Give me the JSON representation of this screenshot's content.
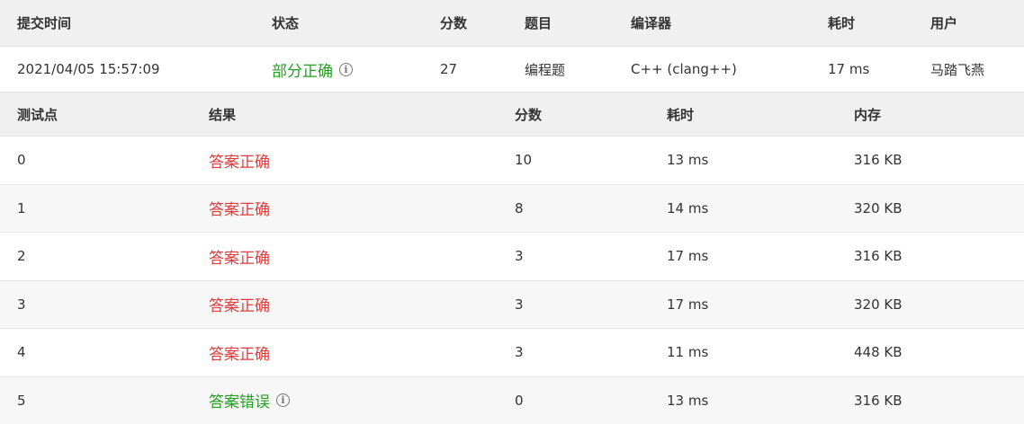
{
  "colors": {
    "accepted": "#e03c3c",
    "partial": "#22a022",
    "wrong": "#22a022",
    "header_bg": "#f0f0f0"
  },
  "submission": {
    "headers": {
      "time": "提交时间",
      "status": "状态",
      "score": "分数",
      "problem": "题目",
      "compiler": "编译器",
      "duration": "耗时",
      "user": "用户"
    },
    "time": "2021/04/05 15:57:09",
    "status": "部分正确",
    "status_icon": "info-icon",
    "score": "27",
    "problem": "编程题",
    "compiler": "C++ (clang++)",
    "duration": "17 ms",
    "user": "马踏飞燕"
  },
  "cases": {
    "headers": {
      "id": "测试点",
      "result": "结果",
      "score": "分数",
      "duration": "耗时",
      "memory": "内存"
    },
    "rows": [
      {
        "id": "0",
        "result": "答案正确",
        "kind": "accepted",
        "score": "10",
        "duration": "13 ms",
        "memory": "316 KB"
      },
      {
        "id": "1",
        "result": "答案正确",
        "kind": "accepted",
        "score": "8",
        "duration": "14 ms",
        "memory": "320 KB"
      },
      {
        "id": "2",
        "result": "答案正确",
        "kind": "accepted",
        "score": "3",
        "duration": "17 ms",
        "memory": "316 KB"
      },
      {
        "id": "3",
        "result": "答案正确",
        "kind": "accepted",
        "score": "3",
        "duration": "17 ms",
        "memory": "320 KB"
      },
      {
        "id": "4",
        "result": "答案正确",
        "kind": "accepted",
        "score": "3",
        "duration": "11 ms",
        "memory": "448 KB"
      },
      {
        "id": "5",
        "result": "答案错误",
        "kind": "wrong",
        "score": "0",
        "duration": "13 ms",
        "memory": "316 KB",
        "has_icon": true
      }
    ]
  }
}
